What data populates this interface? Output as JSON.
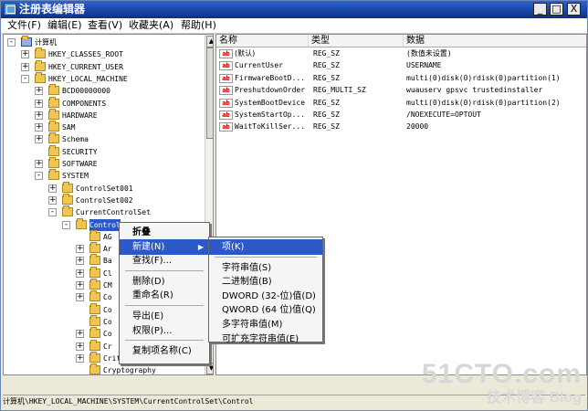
{
  "window": {
    "title": "注册表编辑器",
    "controls": {
      "minimize": "_",
      "maximize": "□",
      "close": "X"
    }
  },
  "menu": [
    "文件(F)",
    "编辑(E)",
    "查看(V)",
    "收藏夹(A)",
    "帮助(H)"
  ],
  "tree": {
    "items": [
      {
        "label": "计算机",
        "level": 0,
        "expander": "-"
      },
      {
        "label": "HKEY_CLASSES_ROOT",
        "level": 1,
        "expander": "+"
      },
      {
        "label": "HKEY_CURRENT_USER",
        "level": 1,
        "expander": "+"
      },
      {
        "label": "HKEY_LOCAL_MACHINE",
        "level": 1,
        "expander": "-"
      },
      {
        "label": "BCD00000000",
        "level": 2,
        "expander": "+"
      },
      {
        "label": "COMPONENTS",
        "level": 2,
        "expander": "+"
      },
      {
        "label": "HARDWARE",
        "level": 2,
        "expander": "+"
      },
      {
        "label": "SAM",
        "level": 2,
        "expander": "+"
      },
      {
        "label": "Schema",
        "level": 2,
        "expander": "+"
      },
      {
        "label": "SECURITY",
        "level": 2,
        "expander": ""
      },
      {
        "label": "SOFTWARE",
        "level": 2,
        "expander": "+"
      },
      {
        "label": "SYSTEM",
        "level": 2,
        "expander": "-"
      },
      {
        "label": "ControlSet001",
        "level": 3,
        "expander": "+"
      },
      {
        "label": "ControlSet002",
        "level": 3,
        "expander": "+"
      },
      {
        "label": "CurrentControlSet",
        "level": 3,
        "expander": "-"
      },
      {
        "label": "Control",
        "level": 4,
        "expander": "-",
        "selected": true
      },
      {
        "label": "AG",
        "level": 5,
        "expander": ""
      },
      {
        "label": "Ar",
        "level": 5,
        "expander": "+"
      },
      {
        "label": "Ba",
        "level": 5,
        "expander": "+"
      },
      {
        "label": "Cl",
        "level": 5,
        "expander": "+"
      },
      {
        "label": "CM",
        "level": 5,
        "expander": "+"
      },
      {
        "label": "Co",
        "level": 5,
        "expander": "+"
      },
      {
        "label": "Co",
        "level": 5,
        "expander": ""
      },
      {
        "label": "Co",
        "level": 5,
        "expander": ""
      },
      {
        "label": "Co",
        "level": 5,
        "expander": "+"
      },
      {
        "label": "Cr",
        "level": 5,
        "expander": "+"
      },
      {
        "label": "CriticalDeviceDatabase",
        "level": 5,
        "expander": "+"
      },
      {
        "label": "Cryptography",
        "level": 5,
        "expander": ""
      }
    ]
  },
  "values": {
    "headers": [
      "名称",
      "类型",
      "数据"
    ],
    "rows": [
      {
        "name": "(默认)",
        "type": "REG_SZ",
        "data": "(数值未设置)"
      },
      {
        "name": "CurrentUser",
        "type": "REG_SZ",
        "data": "USERNAME"
      },
      {
        "name": "FirmwareBootD...",
        "type": "REG_SZ",
        "data": "multi(0)disk(0)rdisk(0)partition(1)"
      },
      {
        "name": "PreshutdownOrder",
        "type": "REG_MULTI_SZ",
        "data": "wuauserv gpsvc trustedinstaller"
      },
      {
        "name": "SystemBootDevice",
        "type": "REG_SZ",
        "data": "multi(0)disk(0)rdisk(0)partition(2)"
      },
      {
        "name": "SystemStartOp...",
        "type": "REG_SZ",
        "data": "/NOEXECUTE=OPTOUT"
      },
      {
        "name": "WaitToKillSer...",
        "type": "REG_SZ",
        "data": "20000"
      }
    ]
  },
  "context_menu": {
    "items": [
      {
        "label": "折叠",
        "bold": true
      },
      {
        "label": "新建(N)",
        "highlight": true,
        "submenu": true
      },
      {
        "label": "查找(F)..."
      },
      {
        "separator": true
      },
      {
        "label": "删除(D)"
      },
      {
        "label": "重命名(R)"
      },
      {
        "separator": true
      },
      {
        "label": "导出(E)"
      },
      {
        "label": "权限(P)..."
      },
      {
        "separator": true
      },
      {
        "label": "复制项名称(C)"
      }
    ]
  },
  "submenu": {
    "items": [
      {
        "label": "项(K)",
        "highlight": true
      },
      {
        "separator": true
      },
      {
        "label": "字符串值(S)"
      },
      {
        "label": "二进制值(B)"
      },
      {
        "label": "DWORD (32-位)值(D)"
      },
      {
        "label": "QWORD (64 位)值(Q)"
      },
      {
        "label": "多字符串值(M)"
      },
      {
        "label": "可扩充字符串值(E)"
      }
    ]
  },
  "statusbar": "计算机\\HKEY_LOCAL_MACHINE\\SYSTEM\\CurrentControlSet\\Control",
  "watermark": {
    "main": "51CTO.com",
    "sub": "技术博客  Blog"
  }
}
